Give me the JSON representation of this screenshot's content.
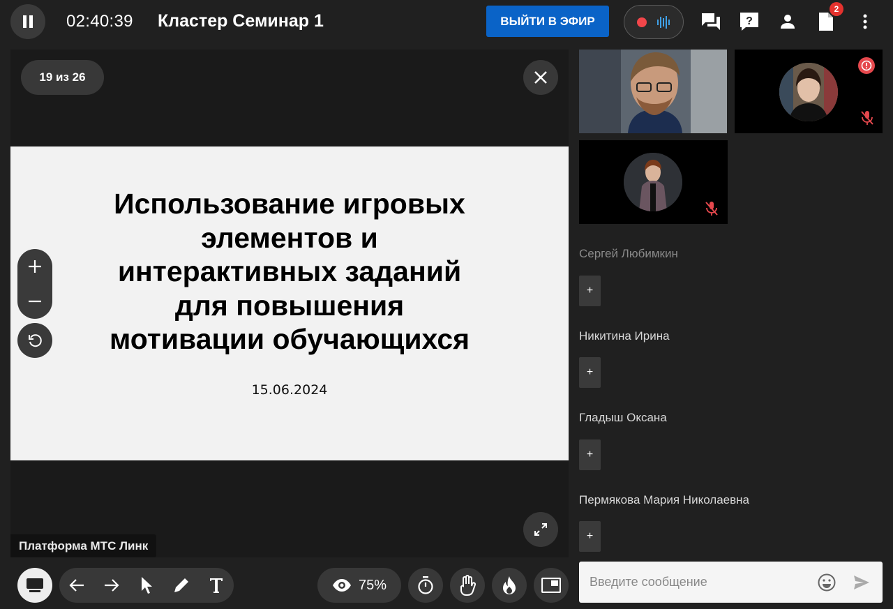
{
  "header": {
    "timer": "02:40:39",
    "room_title": "Кластер Семинар 1",
    "live_button": "ВЫЙТИ В ЭФИР",
    "files_badge": "2",
    "icons": [
      "pause-icon",
      "record-icon",
      "audio-levels-icon",
      "chat-icon",
      "help-icon",
      "person-icon",
      "file-icon",
      "more-vert-icon"
    ]
  },
  "presentation": {
    "page_counter": "19 из 26",
    "slide_title": "Использование игровых\nэлементов и\nинтерактивных заданий\nдля повышения\nмотивации обучающихся",
    "slide_date": "15.06.2024",
    "platform_label": "Платформа МТС Линк",
    "zoom_in": "+",
    "zoom_out": "–"
  },
  "toolbar": {
    "view_percent": "75%",
    "icons": [
      "screen-share-icon",
      "arrow-left-icon",
      "arrow-right-icon",
      "pointer-icon",
      "pencil-icon",
      "text-icon",
      "eye-icon",
      "timer-icon",
      "raise-hand-icon",
      "fire-icon",
      "picture-in-picture-icon"
    ]
  },
  "participants": [
    {
      "name": "Сергей Любимкин",
      "add": "+",
      "muted": false,
      "active": false
    },
    {
      "name": "Никитина Ирина",
      "add": "+",
      "muted": true,
      "active": true
    },
    {
      "name": "Гладыш Оксана",
      "add": "+",
      "muted": true,
      "active": true
    },
    {
      "name": "Пермякова Мария Николаевна",
      "add": "+",
      "muted": false,
      "active": true
    }
  ],
  "chat": {
    "placeholder": "Введите сообщение"
  },
  "colors": {
    "accent": "#0a63c7",
    "record": "#f2464a",
    "alert": "#e5484d",
    "background": "#202020"
  }
}
